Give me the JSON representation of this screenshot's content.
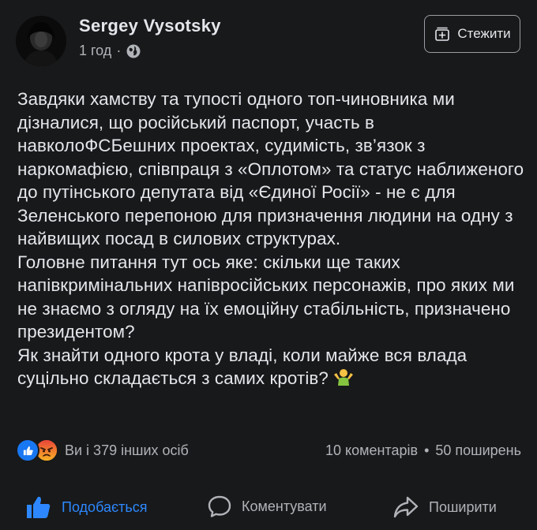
{
  "post": {
    "author": "Sergey  Vysotsky",
    "time": "1 год",
    "separator": "·",
    "follow_label": "Стежити",
    "paragraphs": [
      "Завдяки хамству та тупості одного топ-чиновника ми дізналися, що російський паспорт, участь в навколоФСБешних проектах, судимість, зв’язок з наркомафією, співпраця з «Оплотом» та статус наближеного до путінського депутата від «Єдиної Росії» - не є для Зеленського перепоною для призначення людини на одну з найвищих посад в силових структурах.",
      "Головне питання тут ось яке: скільки ще таких напівкримінальних напівросійських персонажів, про яких ми не знаємо з огляду на їх емоційну стабільність, призначено президентом?",
      "Як знайти одного крота у владі, коли майже вся влада суцільно складається з самих кротів?"
    ],
    "emoji": "person-shrugging"
  },
  "stats": {
    "reactors": "Ви і 379 інших осіб",
    "comments": "10 коментарів",
    "dot": "•",
    "shares": "50 поширень",
    "reaction_icons": [
      "like",
      "angry"
    ]
  },
  "actions": {
    "like": "Подобається",
    "comment": "Коментувати",
    "share": "Поширити"
  },
  "colors": {
    "background": "#18191a",
    "text": "#e4e6eb",
    "secondary": "#b0b3b8",
    "accent": "#2d88ff"
  }
}
